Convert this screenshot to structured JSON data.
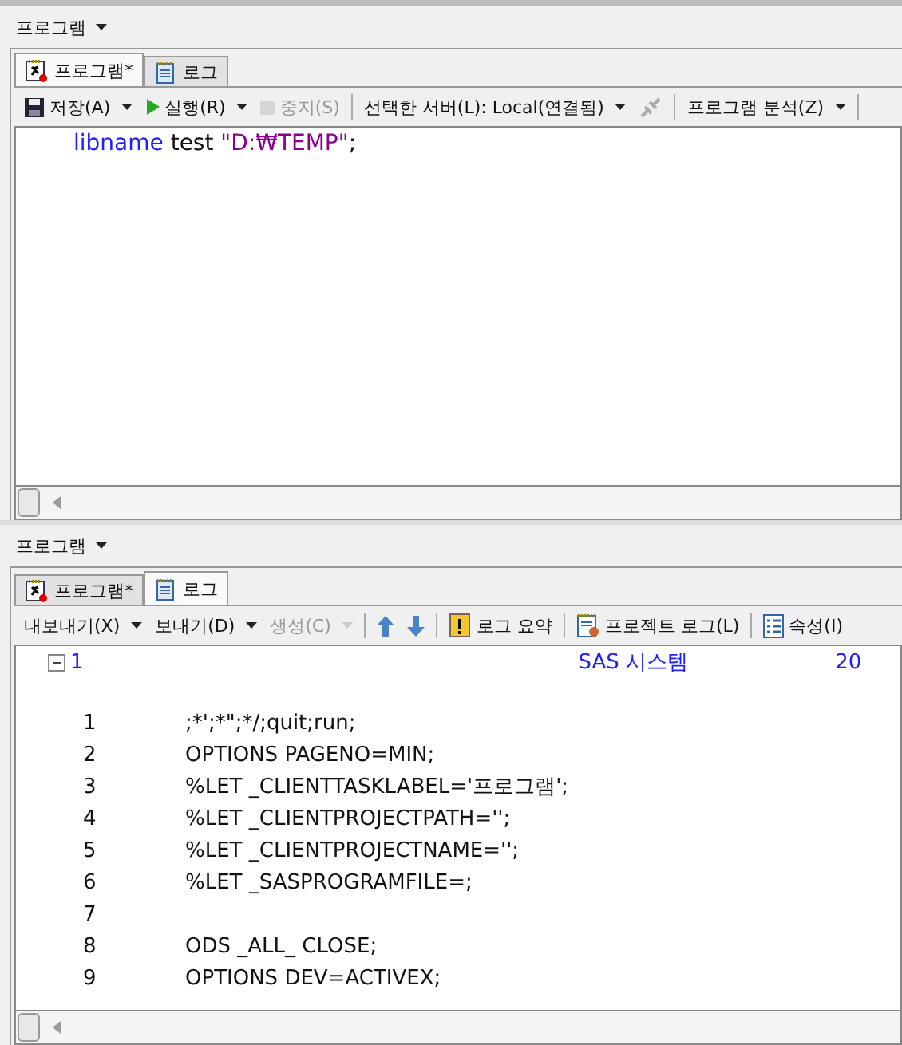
{
  "top_pane": {
    "title": "프로그램",
    "tabs": [
      {
        "label": "프로그램*",
        "kind": "program",
        "selected": true
      },
      {
        "label": "로그",
        "kind": "log",
        "selected": false
      }
    ],
    "toolbar": [
      {
        "kind": "save",
        "label": "저장(A)",
        "menu": true,
        "disabled": false
      },
      {
        "kind": "run",
        "label": "실행(R)",
        "menu": true,
        "disabled": false
      },
      {
        "kind": "stop",
        "label": "중지(S)",
        "menu": false,
        "disabled": true
      },
      {
        "kind": "sep"
      },
      {
        "kind": "text",
        "label": "선택한 서버(L): Local(연결됨)",
        "menu": true,
        "disabled": false
      },
      {
        "kind": "plug",
        "disabled": true
      },
      {
        "kind": "sep"
      },
      {
        "kind": "text",
        "label": "프로그램 분석(Z)",
        "menu": true,
        "disabled": false
      },
      {
        "kind": "sep"
      }
    ],
    "code": [
      {
        "keyword": "libname",
        "rest": " test ",
        "string": "\"D:₩TEMP\"",
        "end": ";"
      }
    ]
  },
  "bottom_pane": {
    "title": "프로그램",
    "tabs": [
      {
        "label": "프로그램*",
        "kind": "program",
        "selected": false
      },
      {
        "label": "로그",
        "kind": "log",
        "selected": true
      }
    ],
    "toolbar": [
      {
        "kind": "text",
        "label": "내보내기(X)",
        "menu": true,
        "disabled": false
      },
      {
        "kind": "text",
        "label": "보내기(D)",
        "menu": true,
        "disabled": false
      },
      {
        "kind": "text",
        "label": "생성(C)",
        "menu": true,
        "disabled": true
      },
      {
        "kind": "sep"
      },
      {
        "kind": "up",
        "disabled": false
      },
      {
        "kind": "down",
        "disabled": false
      },
      {
        "kind": "sep"
      },
      {
        "kind": "summary",
        "label": "로그 요약",
        "menu": false,
        "disabled": false
      },
      {
        "kind": "sep"
      },
      {
        "kind": "projlog",
        "label": "프로젝트 로그(L)",
        "menu": false,
        "disabled": false
      },
      {
        "kind": "sep"
      },
      {
        "kind": "props",
        "label": "속성(I)",
        "menu": false,
        "disabled": false
      }
    ],
    "log_header": {
      "page": "1",
      "title": "SAS 시스템",
      "date": "20",
      "expanded": true
    },
    "log_lines": [
      {
        "num": "1",
        "code": ";*';*\";*/;quit;run;"
      },
      {
        "num": "2",
        "code": "OPTIONS PAGENO=MIN;"
      },
      {
        "num": "3",
        "code": "%LET _CLIENTTASKLABEL='프로그램';"
      },
      {
        "num": "4",
        "code": "%LET _CLIENTPROJECTPATH='';"
      },
      {
        "num": "5",
        "code": "%LET _CLIENTPROJECTNAME='';"
      },
      {
        "num": "6",
        "code": "%LET _SASPROGRAMFILE=;"
      },
      {
        "num": "7"
      },
      {
        "num": "8",
        "code": "ODS _ALL_ CLOSE;"
      },
      {
        "num": "9",
        "code": "OPTIONS DEV=ACTIVEX;"
      }
    ]
  }
}
